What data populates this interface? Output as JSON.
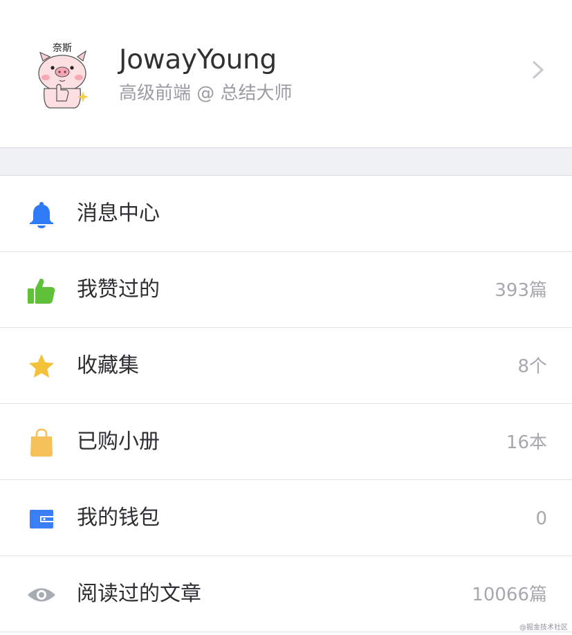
{
  "profile": {
    "username": "JowayYoung",
    "bio": "高级前端 @ 总结大师",
    "avatar_text": "奈斯",
    "avatar_icon": "pig-avatar-icon"
  },
  "menu": [
    {
      "label": "消息中心",
      "count": "",
      "icon": "bell-icon",
      "color": "#2f7bf5"
    },
    {
      "label": "我赞过的",
      "count": "393篇",
      "icon": "thumbs-up-icon",
      "color": "#5fc138"
    },
    {
      "label": "收藏集",
      "count": "8个",
      "icon": "star-icon",
      "color": "#f4c13b"
    },
    {
      "label": "已购小册",
      "count": "16本",
      "icon": "bag-icon",
      "color": "#f6c05b"
    },
    {
      "label": "我的钱包",
      "count": "0",
      "icon": "wallet-icon",
      "color": "#3a7ff6"
    },
    {
      "label": "阅读过的文章",
      "count": "10066篇",
      "icon": "eye-icon",
      "color": "#a7abb2"
    }
  ],
  "watermark": "@掘金技术社区"
}
